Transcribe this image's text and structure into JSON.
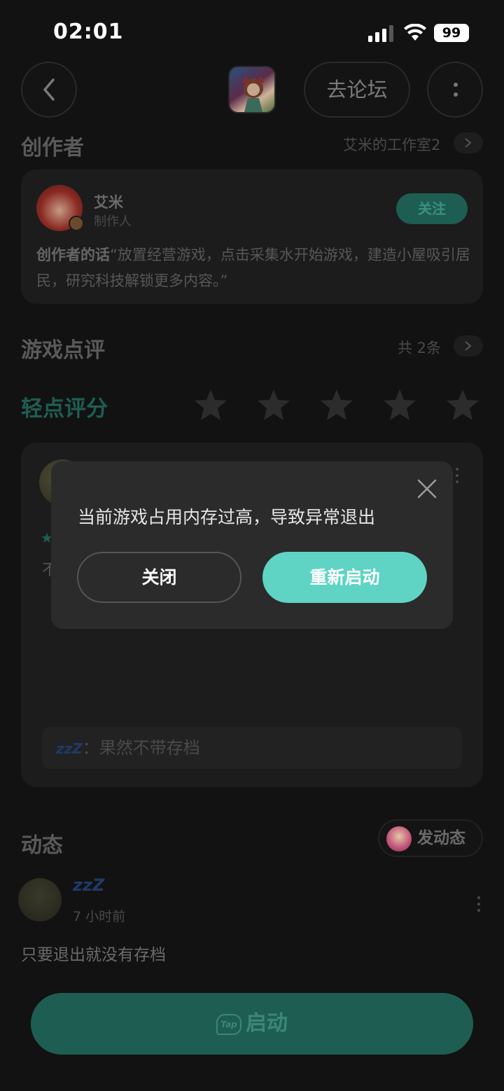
{
  "status_bar": {
    "time": "02:01",
    "battery": "99"
  },
  "nav": {
    "forum_label": "去论坛"
  },
  "creator": {
    "section_title": "创作者",
    "studio_link": "艾米的工作室2",
    "name": "艾米",
    "role": "制作人",
    "follow_label": "关注",
    "quote_label": "创作者的话",
    "quote_text": "“放置经营游戏，点击采集水开始游戏，建造小屋吸引居民，研究科技解锁更多内容。”"
  },
  "reviews": {
    "section_title": "游戏点评",
    "count_link": "共 2条",
    "rate_label": "轻点评分",
    "stars": 5,
    "reply_user": "zzZ",
    "reply_text": "果然不带存档",
    "reply_sep": "："
  },
  "feed": {
    "section_title": "动态",
    "post_button": "发动态",
    "user": "zzZ",
    "time": "7 小时前",
    "text": "只要退出就没有存档"
  },
  "launch": {
    "label": "启动",
    "tap_logo": "Tap"
  },
  "dialog": {
    "message": "当前游戏占用内存过高，导致异常退出",
    "close_label": "关闭",
    "restart_label": "重新启动"
  },
  "colors": {
    "accent": "#5fd4c4",
    "dim_accent": "#1e5e52",
    "background": "#121212",
    "dialog": "#2b2b2b"
  }
}
